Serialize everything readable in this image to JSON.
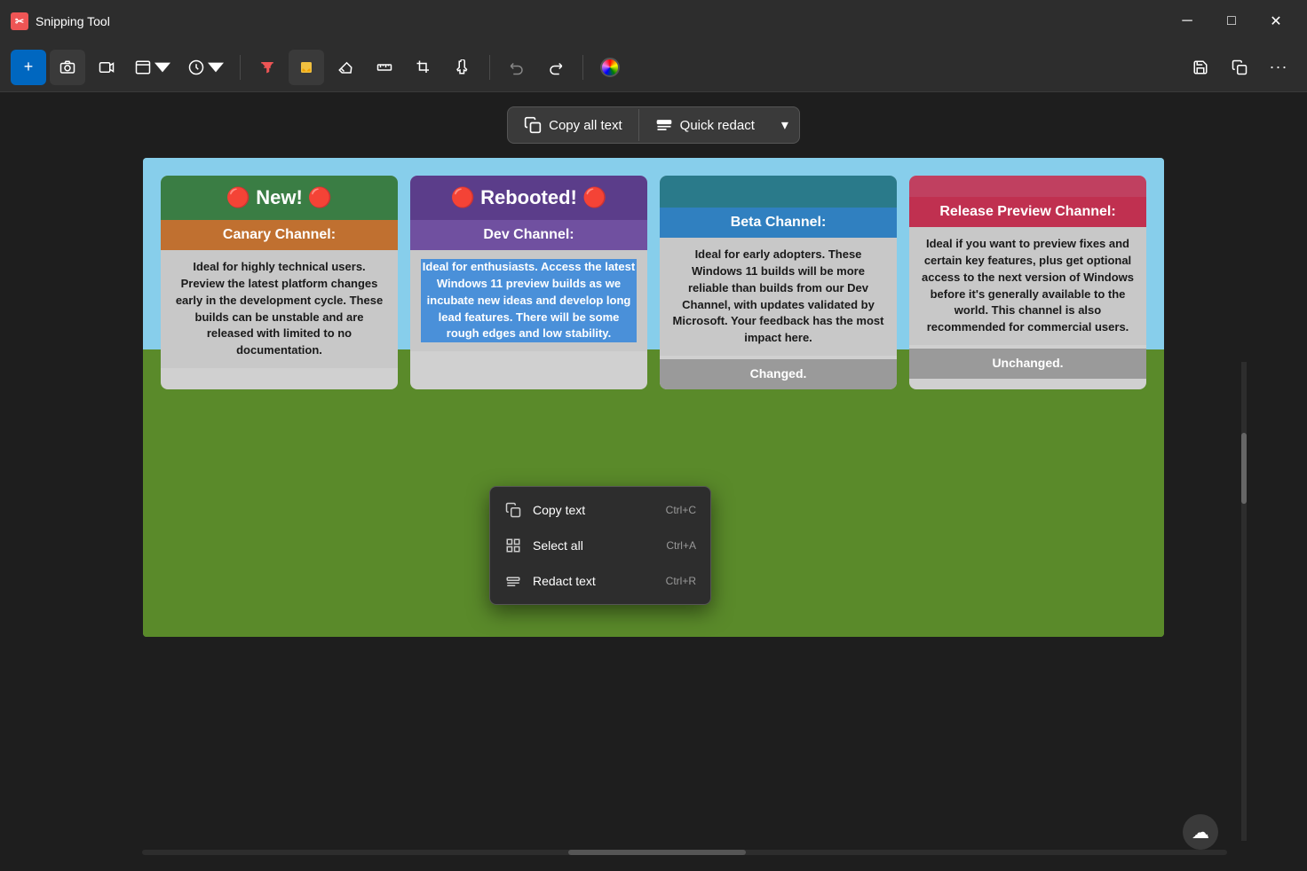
{
  "titlebar": {
    "title": "Snipping Tool",
    "min_label": "─",
    "max_label": "□",
    "close_label": "✕"
  },
  "toolbar": {
    "new_label": "+",
    "camera_tooltip": "Screenshot",
    "video_tooltip": "Video",
    "window_tooltip": "Window",
    "recents_tooltip": "Recents",
    "filter_tooltip": "Filter",
    "highlight_tooltip": "Highlight",
    "eraser_tooltip": "Eraser",
    "ruler_tooltip": "Ruler",
    "crop_tooltip": "Crop",
    "touch_tooltip": "Touch",
    "undo_tooltip": "Undo",
    "redo_tooltip": "Redo",
    "color_tooltip": "Color",
    "save_tooltip": "Save",
    "copy_tooltip": "Copy",
    "more_tooltip": "More"
  },
  "action_bar": {
    "copy_all_text_label": "Copy all text",
    "quick_redact_label": "Quick redact",
    "dropdown_label": "▾"
  },
  "context_menu": {
    "items": [
      {
        "label": "Copy text",
        "shortcut": "Ctrl+C",
        "icon": "copy"
      },
      {
        "label": "Select all",
        "shortcut": "Ctrl+A",
        "icon": "select-all"
      },
      {
        "label": "Redact text",
        "shortcut": "Ctrl+R",
        "icon": "redact"
      }
    ]
  },
  "screenshot": {
    "ocr_icon": "⊙",
    "cards": [
      {
        "header": "🔴 New! 🔴",
        "header_bg": "green",
        "subheader": "Canary Channel:",
        "subheader_bg": "orange",
        "body": "Ideal for highly technical users. Preview the latest platform changes early in the development cycle. These builds can be unstable and are released with limited to no documentation.",
        "footer": null,
        "selected": false
      },
      {
        "header": "🔴 Rebooted! 🔴",
        "header_bg": "purple",
        "subheader": "Dev Channel:",
        "subheader_bg": "purple",
        "body": "Ideal for enthusiasts. Access the latest Windows 11 preview builds as we incubate new ideas and develop long lead features. There will be some rough edges and low stability.",
        "footer": null,
        "selected": true
      },
      {
        "header": "",
        "header_bg": "teal",
        "subheader": "Beta Channel:",
        "subheader_bg": "blue",
        "body": "Ideal for early adopters. These Windows 11 builds will be more reliable than builds from our Dev Channel, with updates validated by Microsoft. Your feedback has the most impact here.",
        "footer": "Changed.",
        "selected": false
      },
      {
        "header": "",
        "header_bg": "pink",
        "subheader": "Release Preview Channel:",
        "subheader_bg": "red",
        "body": "Ideal if you want to preview fixes and certain key features, plus get optional access to the next version of Windows before it's generally available to the world. This channel is also recommended for commercial users.",
        "footer": "Unchanged.",
        "selected": false
      }
    ]
  },
  "bottom": {
    "icon": "☁"
  }
}
